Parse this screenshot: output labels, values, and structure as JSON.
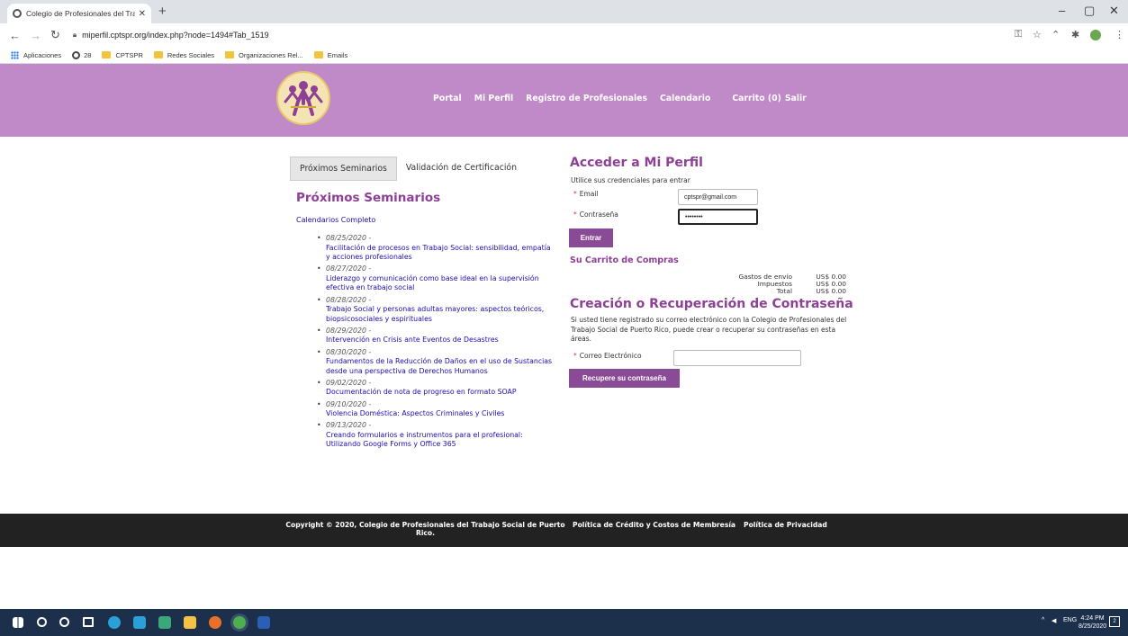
{
  "browser": {
    "tab_title": "Colegio de Profesionales del Trab",
    "tab_close": "✕",
    "new_tab": "+",
    "window_controls": {
      "minimize": "–",
      "maximize": "▢",
      "close": "✕"
    },
    "url": "miperfil.cptspr.org/index.php?node=1494#Tab_1519",
    "bookmarks": [
      {
        "label": "Aplicaciones",
        "icon": "apps-grid-icon"
      },
      {
        "label": "28",
        "icon": "globe-icon"
      },
      {
        "label": "CPTSPR",
        "icon": "folder-icon"
      },
      {
        "label": "Redes Sociales",
        "icon": "folder-icon"
      },
      {
        "label": "Organizaciones Rel...",
        "icon": "folder-icon"
      },
      {
        "label": "Emails",
        "icon": "folder-icon"
      }
    ]
  },
  "nav": {
    "portal": "Portal",
    "mi_perfil": "Mi Perfil",
    "registro": "Registro de Profesionales",
    "calendario": "Calendario",
    "carrito": "Carrito (0)",
    "salir": "Salir"
  },
  "tabs": {
    "proximos": "Próximos Seminarios",
    "validacion": "Validación de Certificación"
  },
  "seminars": {
    "heading": "Próximos Seminarios",
    "calendar_link": "Calendarios Completo",
    "items": [
      {
        "date": "08/25/2020 -",
        "title": "Facilitación de procesos en Trabajo Social: sensibilidad, empatía y acciones profesionales"
      },
      {
        "date": "08/27/2020 -",
        "title": "Liderazgo y comunicación como base ideal en la supervisión efectiva en trabajo social"
      },
      {
        "date": "08/28/2020 -",
        "title": "Trabajo Social y personas adultas mayores: aspectos teóricos, biopsicosociales y espirituales"
      },
      {
        "date": "08/29/2020 -",
        "title": "Intervención en Crisis ante Eventos de Desastres"
      },
      {
        "date": "08/30/2020 -",
        "title": "Fundamentos de la Reducción de Daños en el uso de Sustancias desde una perspectiva de Derechos Humanos"
      },
      {
        "date": "09/02/2020 -",
        "title": "Documentación de nota de progreso en formato SOAP"
      },
      {
        "date": "09/10/2020 -",
        "title": "Violencia Doméstica: Aspectos Criminales y Civiles"
      },
      {
        "date": "09/13/2020 -",
        "title": "Creando formularios e instrumentos para el profesional: Utilizando Google Forms y Office 365"
      }
    ]
  },
  "login": {
    "heading": "Acceder a Mi Perfil",
    "subtitle": "Utilice sus credenciales para entrar",
    "email_label": "Email",
    "email_value": "cptspr@gmail.com",
    "password_label": "Contraseña",
    "password_value": "••••••••",
    "submit": "Entrar"
  },
  "cart": {
    "heading": "Su Carrito de Compras",
    "rows": [
      {
        "label": "Gastos de envío",
        "value": "US$ 0.00"
      },
      {
        "label": "Impuestos",
        "value": "US$ 0.00"
      },
      {
        "label": "Total",
        "value": "US$ 0.00"
      }
    ]
  },
  "recover": {
    "heading": "Creación o Recuperación de Contraseña",
    "text": "Si usted tiene registrado su correo electrónico con la Colegio de Profesionales del Trabajo Social de Puerto Rico, puede crear o recuperar su contraseñas en esta áreas.",
    "email_label": "Correo Electrónico",
    "email_value": "",
    "submit": "Recupere su contraseña"
  },
  "footer": {
    "copyright": "Copyright © 2020, Colegio de Profesionales del Trabajo Social de Puerto Rico.",
    "credit_policy": "Política de Crédito y Costos de Membresía",
    "privacy_policy": "Política de Privacidad"
  },
  "taskbar": {
    "tray_lang": "ENG",
    "time": "4:24 PM",
    "date": "8/25/2020",
    "notifications": "2"
  },
  "colors": {
    "header_bg": "#c089c7",
    "heading": "#8e3f96",
    "button": "#8a4b96",
    "footer_bg": "#222222",
    "taskbar_bg": "#1c2f4b"
  }
}
